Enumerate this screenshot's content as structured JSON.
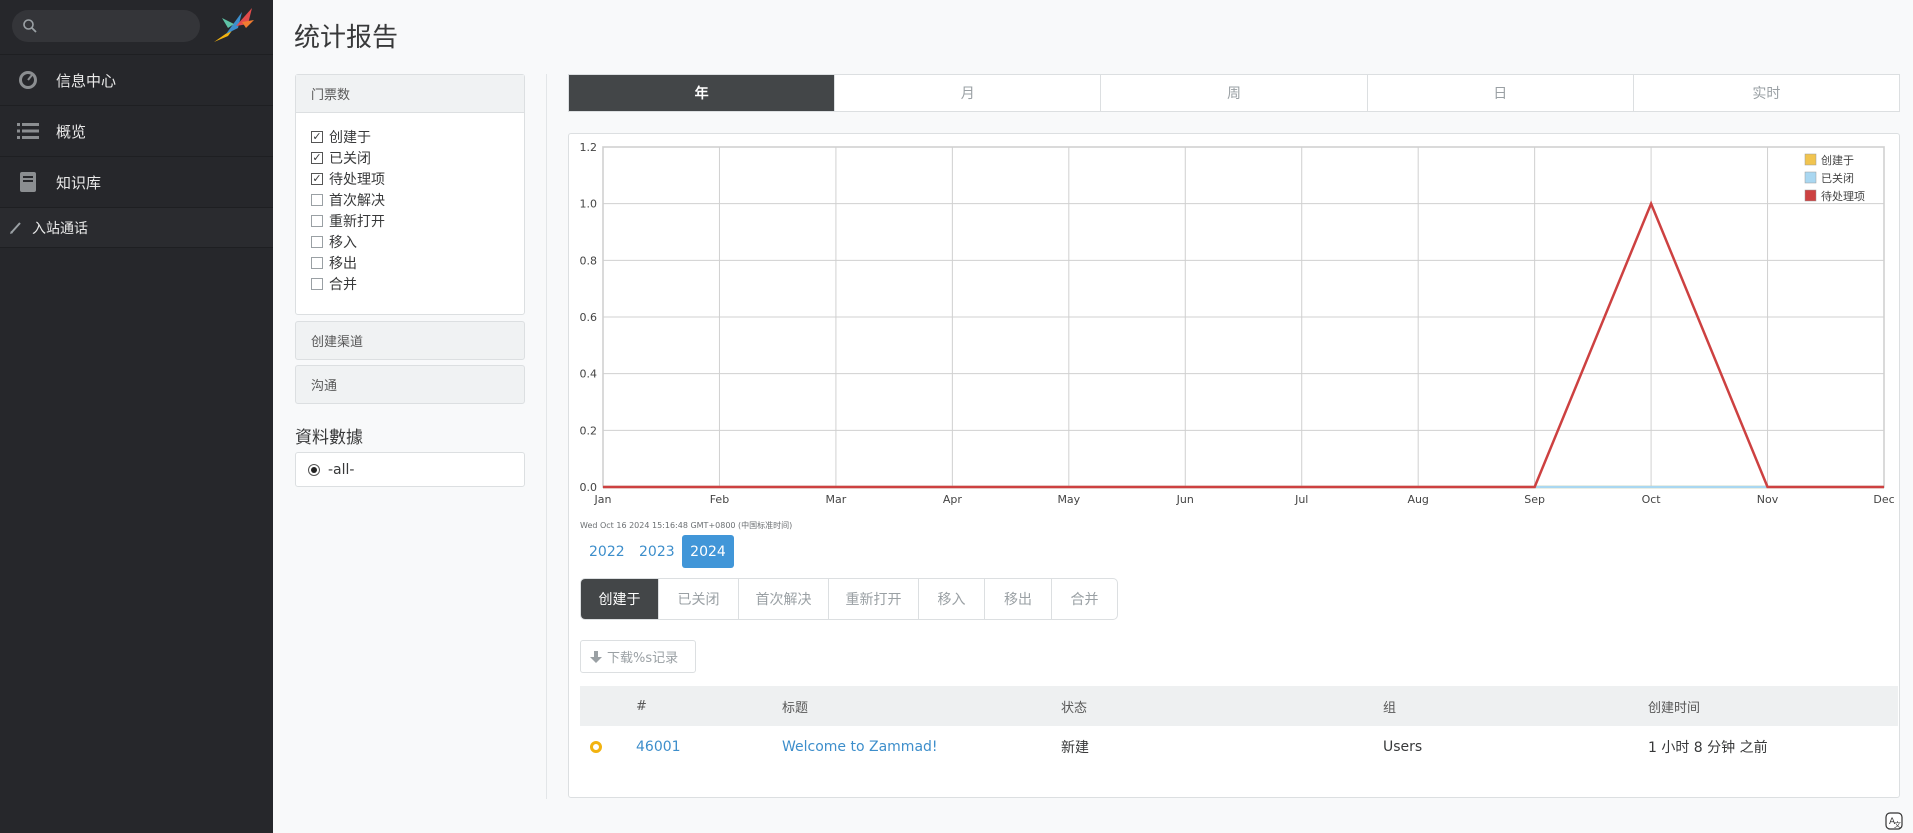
{
  "sidebar": {
    "search_placeholder": "",
    "nav": [
      {
        "label": "信息中心",
        "icon": "dashboard-icon"
      },
      {
        "label": "概览",
        "icon": "list-icon"
      },
      {
        "label": "知识库",
        "icon": "book-icon"
      }
    ],
    "sub": {
      "label": "入站通话",
      "icon": "pencil-icon"
    }
  },
  "page": {
    "title": "统计报告"
  },
  "filters": {
    "ticket_count": {
      "title": "门票数",
      "items": [
        {
          "label": "创建于",
          "checked": true
        },
        {
          "label": "已关闭",
          "checked": true
        },
        {
          "label": "待处理项",
          "checked": true
        },
        {
          "label": "首次解决",
          "checked": false
        },
        {
          "label": "重新打开",
          "checked": false
        },
        {
          "label": "移入",
          "checked": false
        },
        {
          "label": "移出",
          "checked": false
        },
        {
          "label": "合并",
          "checked": false
        }
      ]
    },
    "channel_title": "创建渠道",
    "communication_title": "沟通",
    "profile_title": "資料數據",
    "profile_value": "-all-"
  },
  "period_tabs": [
    "年",
    "月",
    "周",
    "日",
    "实时"
  ],
  "chart_data": {
    "type": "line",
    "categories": [
      "Jan",
      "Feb",
      "Mar",
      "Apr",
      "May",
      "Jun",
      "Jul",
      "Aug",
      "Sep",
      "Oct",
      "Nov",
      "Dec"
    ],
    "yticks": [
      "0.0",
      "0.2",
      "0.4",
      "0.6",
      "0.8",
      "1.0",
      "1.2"
    ],
    "ylim": [
      0,
      1.2
    ],
    "grid": true,
    "legend_position": "top-right",
    "series": [
      {
        "name": "创建于",
        "color": "#f1c44f",
        "values": [
          0,
          0,
          0,
          0,
          0,
          0,
          0,
          0,
          0,
          0,
          0,
          0
        ]
      },
      {
        "name": "已关闭",
        "color": "#a9d7f1",
        "values": [
          0,
          0,
          0,
          0,
          0,
          0,
          0,
          0,
          0,
          0,
          0,
          0
        ]
      },
      {
        "name": "待处理项",
        "color": "#cd4141",
        "values": [
          0,
          0,
          0,
          0,
          0,
          0,
          0,
          0,
          0,
          1,
          0,
          0
        ]
      }
    ],
    "timestamp": "Wed Oct 16 2024 15:16:48 GMT+0800 (中国标准时间)"
  },
  "years": [
    "2022",
    "2023",
    "2024"
  ],
  "active_year": "2024",
  "type_tabs": [
    "创建于",
    "已关闭",
    "首次解决",
    "重新打开",
    "移入",
    "移出",
    "合并"
  ],
  "download_label": "下载%s记录",
  "table": {
    "headers": [
      "#",
      "标题",
      "状态",
      "组",
      "创建时间"
    ],
    "rows": [
      {
        "number": "46001",
        "title": "Welcome to Zammad!",
        "state": "新建",
        "group": "Users",
        "created": "1 小时 8 分钟 之前"
      }
    ]
  },
  "colors": {
    "accent": "#4196d8",
    "sidebar_bg": "#26272b",
    "status_new": "#f2b310"
  }
}
